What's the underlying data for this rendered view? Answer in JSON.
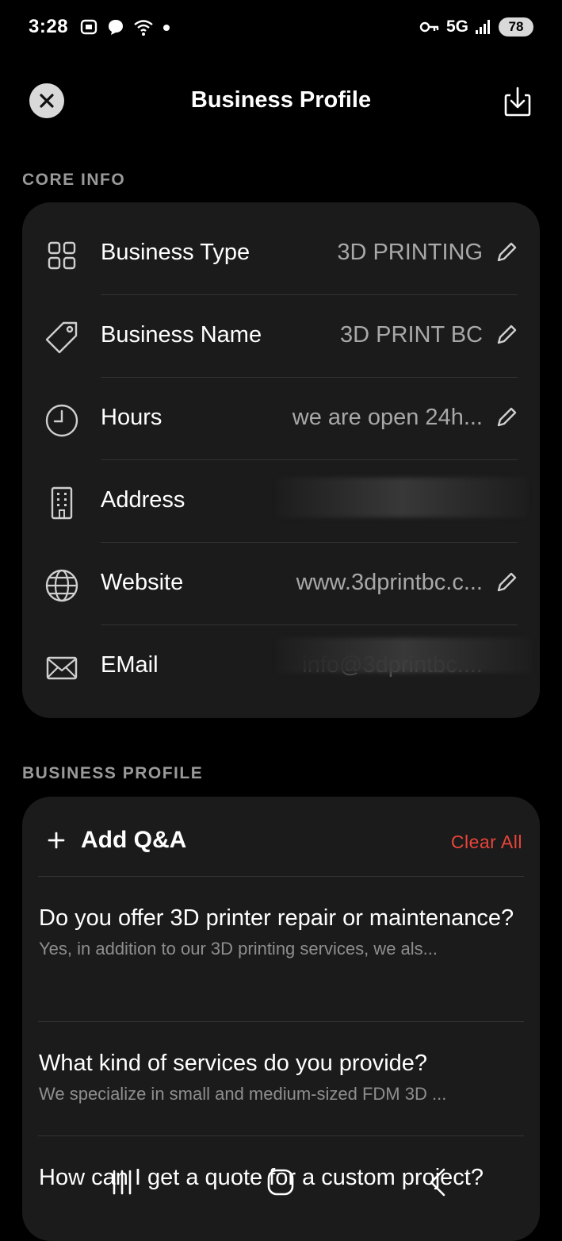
{
  "status_bar": {
    "time": "3:28",
    "network": "5G",
    "battery": "78",
    "icons_left": [
      "screenshot-icon",
      "chat-bubble-icon",
      "wifi-icon",
      "dot-icon"
    ],
    "icons_right": [
      "vpn-key-icon",
      "signal-icon",
      "battery-icon"
    ]
  },
  "header": {
    "title": "Business Profile",
    "close_icon": "close-icon",
    "download_icon": "download-icon"
  },
  "core_info": {
    "section_label": "CORE INFO",
    "rows": [
      {
        "icon": "grid-icon",
        "label": "Business Type",
        "value": "3D PRINTING",
        "editable": true
      },
      {
        "icon": "tag-icon",
        "label": "Business Name",
        "value": "3D PRINT BC",
        "editable": true
      },
      {
        "icon": "clock-icon",
        "label": "Hours",
        "value": "we are open 24h...",
        "editable": true
      },
      {
        "icon": "building-icon",
        "label": "Address",
        "value": "",
        "editable": false
      },
      {
        "icon": "globe-icon",
        "label": "Website",
        "value": "www.3dprintbc.c...",
        "editable": true
      },
      {
        "icon": "mail-icon",
        "label": "EMail",
        "value": "info@3dprintbc....",
        "editable": true
      }
    ]
  },
  "business_profile": {
    "section_label": "BUSINESS PROFILE",
    "add_label": "Add Q&A",
    "clear_label": "Clear All",
    "colors": {
      "clear": "#e8453a"
    },
    "qa": [
      {
        "question": "Do you offer 3D printer repair or maintenance?",
        "answer": "Yes, in addition to our 3D printing services, we als..."
      },
      {
        "question": "What kind of services do you provide?",
        "answer": "We specialize in small and medium-sized FDM 3D ..."
      },
      {
        "question": "How can I get a quote for a custom project?",
        "answer": ""
      }
    ]
  },
  "nav_bar": {
    "icons": [
      "recents-icon",
      "home-icon",
      "back-icon"
    ]
  }
}
